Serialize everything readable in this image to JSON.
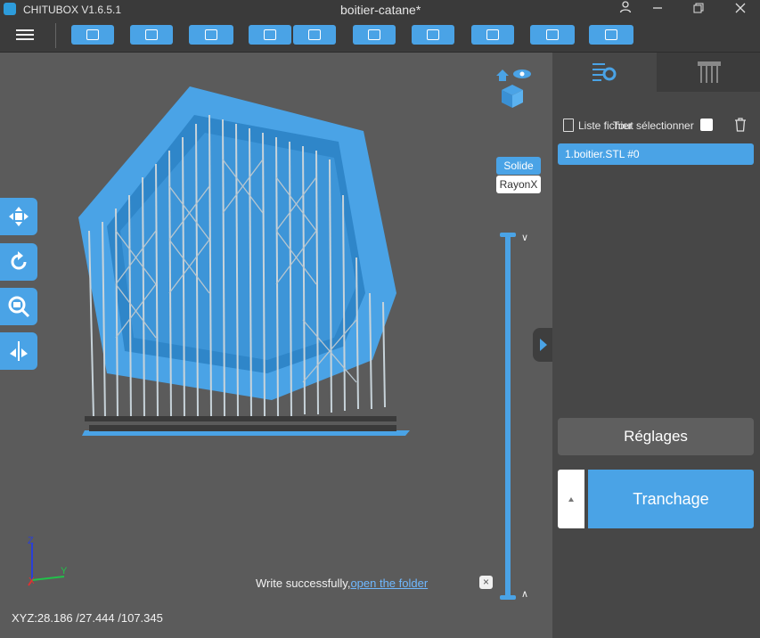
{
  "window": {
    "app_title": "CHITUBOX V1.6.5.1",
    "document_title": "boitier-catane*",
    "controls": [
      "user-icon",
      "minimize-icon",
      "restore-icon",
      "close-icon"
    ]
  },
  "toolbar": {
    "buttons": [
      "open-file-icon",
      "save-icon",
      "select-icon",
      "import-icon",
      "export-icon",
      "copy-icon",
      "layout-icon",
      "hollow-icon",
      "drill-icon",
      "print-icon"
    ]
  },
  "viewport": {
    "modes": {
      "solid": "Solide",
      "xray": "RayonX"
    },
    "tools": [
      "move-icon",
      "rotate-icon",
      "scale-icon",
      "mirror-icon"
    ],
    "status": {
      "text": "Write successfully,",
      "link": "open the folder"
    },
    "coordinates": "XYZ:28.186 /27.444 /107.345",
    "axes": {
      "x": "X",
      "y": "Y",
      "z": "Z"
    }
  },
  "panel": {
    "tabs": [
      "list-settings-icon",
      "supports-icon"
    ],
    "list_title": "Liste fichier",
    "select_all": "Tout sélectionner",
    "items": [
      "1.boitier.STL #0"
    ],
    "settings_button": "Réglages",
    "slice_button": "Tranchage"
  },
  "colors": {
    "accent": "#4aa3e6",
    "background": "#5b5b5b",
    "panel": "#474747",
    "titlebar": "#3a3a3a"
  }
}
